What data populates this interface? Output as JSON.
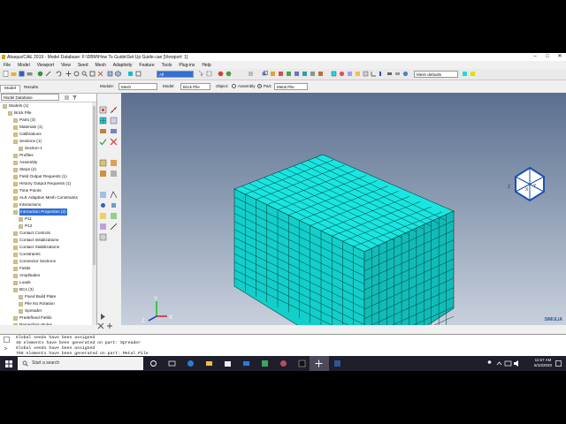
{
  "window": {
    "title": "Abaqus/CAE 2019 - Model Database: F:\\DBM\\How To Guide\\Set Up Guide.cae [Viewport: 1]",
    "controls": [
      "–",
      "□",
      "✕"
    ]
  },
  "menu": [
    "File",
    "Model",
    "Viewport",
    "View",
    "Seed",
    "Mesh",
    "Adaptivity",
    "Feature",
    "Tools",
    "Plug-ins",
    "Help"
  ],
  "toolbar1": {
    "filter_value": "All",
    "mesh_defaults": "Mesh defaults"
  },
  "context_bar": {
    "module_label": "Module:",
    "module_value": "Mesh",
    "model_label": "Model:",
    "model_value": "Brick Pile",
    "object_label": "Object:",
    "assembly_label": "Assembly",
    "part_label": "Part:",
    "part_value": "Metal Pile"
  },
  "tabs": [
    "Model",
    "Results"
  ],
  "tree_selector": "Model Database",
  "tree": [
    {
      "label": "Models (1)",
      "indent": 0
    },
    {
      "label": "Brick Pile",
      "indent": 1
    },
    {
      "label": "Parts (3)",
      "indent": 2
    },
    {
      "label": "Materials (1)",
      "indent": 2
    },
    {
      "label": "Calibrations",
      "indent": 2
    },
    {
      "label": "Sections (1)",
      "indent": 2
    },
    {
      "label": "Section-1",
      "indent": 3
    },
    {
      "label": "Profiles",
      "indent": 2
    },
    {
      "label": "Assembly",
      "indent": 2
    },
    {
      "label": "Steps (2)",
      "indent": 2
    },
    {
      "label": "Field Output Requests (1)",
      "indent": 2
    },
    {
      "label": "History Output Requests (1)",
      "indent": 2
    },
    {
      "label": "Time Points",
      "indent": 2
    },
    {
      "label": "ALE Adaptive Mesh Constraints",
      "indent": 2
    },
    {
      "label": "Interactions",
      "indent": 2
    },
    {
      "label": "Interaction Properties (2)",
      "indent": 2,
      "selected": true
    },
    {
      "label": "P11",
      "indent": 3
    },
    {
      "label": "P12",
      "indent": 3
    },
    {
      "label": "Contact Controls",
      "indent": 2
    },
    {
      "label": "Contact Initializations",
      "indent": 2
    },
    {
      "label": "Contact Stabilizations",
      "indent": 2
    },
    {
      "label": "Constraints",
      "indent": 2
    },
    {
      "label": "Connector Sections",
      "indent": 2
    },
    {
      "label": "Fields",
      "indent": 2
    },
    {
      "label": "Amplitudes",
      "indent": 2
    },
    {
      "label": "Loads",
      "indent": 2
    },
    {
      "label": "BCs (3)",
      "indent": 2
    },
    {
      "label": "Fixed Build Plate",
      "indent": 3
    },
    {
      "label": "Pile No Rotation",
      "indent": 3
    },
    {
      "label": "Spreader",
      "indent": 3
    },
    {
      "label": "Predefined Fields",
      "indent": 2
    },
    {
      "label": "Remeshing Rules",
      "indent": 2
    }
  ],
  "triad": {
    "x": "X",
    "y": "Y",
    "z": "Z"
  },
  "brand": "SIMULIA",
  "messages": [
    "Global seeds have been assigned",
    "48 elements have been generated on part: Spreader",
    "Global seeds have been assigned",
    "768 elements have been generated on part: Metal Pile"
  ],
  "taskbar": {
    "search_placeholder": "Start a search",
    "time": "11:57 AM",
    "date": "6/10/2020"
  },
  "colors": {
    "mesh": "#19e6e0",
    "mesh_side": "#10bcb8",
    "mesh_front": "#12cfca",
    "selection": "#2f6fd6"
  }
}
